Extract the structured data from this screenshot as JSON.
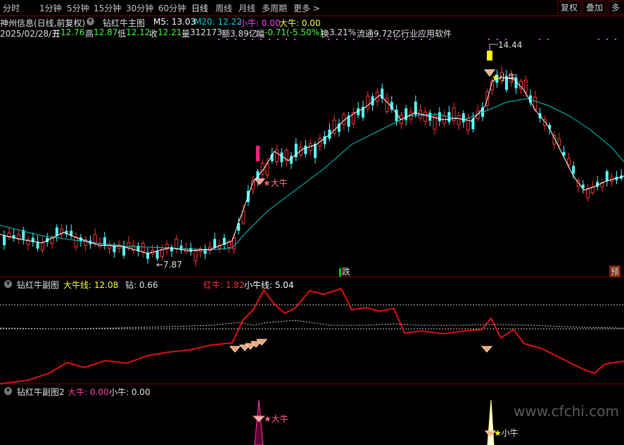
{
  "tabs": [
    "分时",
    "1分钟",
    "5分钟",
    "15分钟",
    "30分钟",
    "60分钟",
    "日线",
    "周线",
    "月线",
    "多周期",
    "更多 >"
  ],
  "active_tab": "日线",
  "right_buttons": [
    "复权",
    "叠加",
    "多"
  ],
  "stock": {
    "name": "神州信息(日线,前复权)",
    "chart_title": "钻红牛主图",
    "ma5": "M5: 13.03",
    "ma20": "M20: 12.22",
    "xiaoniu": "小牛: 0.00",
    "daniu": "大牛: 0.00"
  },
  "quote": {
    "date": "2025/02/28/五",
    "open_lbl": "开",
    "open": "12.76",
    "high_lbl": "高",
    "high": "12.87",
    "low_lbl": "低",
    "low": "12.12",
    "close_lbl": "收",
    "close": "12.21",
    "vol_lbl": "量",
    "vol": "312173",
    "amt_lbl": "额",
    "amt": "3.89亿",
    "chg_lbl": "幅",
    "chg": "-0.71(-5.50%)",
    "turn_lbl": "换",
    "turn": "3.21%",
    "float_lbl": "流通",
    "float": "9.72亿",
    "industry": "行业应用软件"
  },
  "annotations": {
    "high": "14.44",
    "low": "←7.87",
    "daniu_main": "大牛",
    "xiaoniu_main": "小牛",
    "marker_left": "跌",
    "marker_right": "预"
  },
  "sub1": {
    "title": "钻红牛副图",
    "daniu_line": "大牛线: 12.08",
    "zuan": "钻: 0.66",
    "hongniu": "红牛: 1.82",
    "xiaoniu_line": "小牛线: 5.04"
  },
  "sub2": {
    "title": "钻红牛副图2",
    "daniu": "大牛: 0.00",
    "xiaoniu": "小牛: 0.00",
    "daniu_tag": "大牛",
    "xiaoniu_tag": "小牛"
  },
  "watermark": "www.cfchi.com",
  "colors": {
    "up": "#ff3232",
    "down": "#54ffff",
    "ma5": "#ffffff",
    "ma20": "#00c8c8",
    "red_line": "#e01010",
    "bar_border": "#7a0000",
    "magenta": "#ff40ff",
    "yellow": "#ffff00"
  }
}
